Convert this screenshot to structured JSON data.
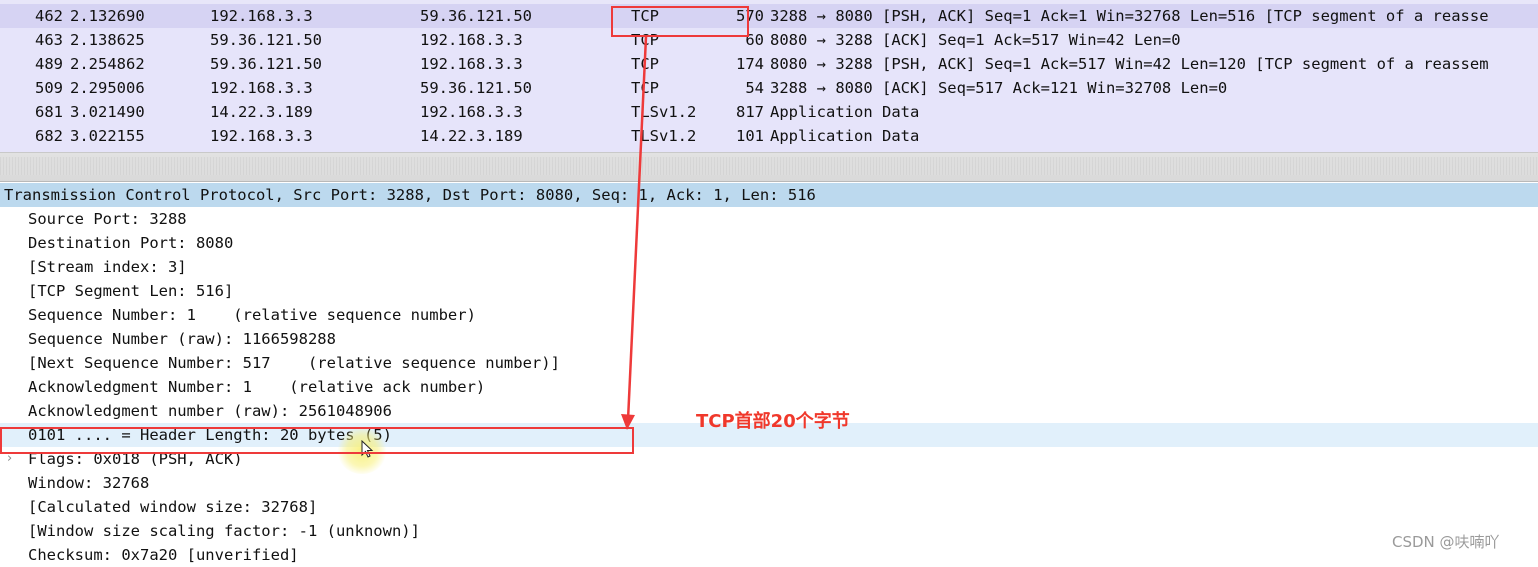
{
  "packet_list": {
    "rows": [
      {
        "no": "462",
        "time": "2.132690",
        "src": "192.168.3.3",
        "dst": "59.36.121.50",
        "proto": "TCP",
        "len": "570",
        "info": "3288 → 8080 [PSH, ACK] Seq=1 Ack=1 Win=32768 Len=516 [TCP segment of a reasse",
        "selected": true
      },
      {
        "no": "463",
        "time": "2.138625",
        "src": "59.36.121.50",
        "dst": "192.168.3.3",
        "proto": "TCP",
        "len": "60",
        "info": "8080 → 3288 [ACK] Seq=1 Ack=517 Win=42 Len=0",
        "selected": false
      },
      {
        "no": "489",
        "time": "2.254862",
        "src": "59.36.121.50",
        "dst": "192.168.3.3",
        "proto": "TCP",
        "len": "174",
        "info": "8080 → 3288 [PSH, ACK] Seq=1 Ack=517 Win=42 Len=120 [TCP segment of a reassem",
        "selected": false
      },
      {
        "no": "509",
        "time": "2.295006",
        "src": "192.168.3.3",
        "dst": "59.36.121.50",
        "proto": "TCP",
        "len": "54",
        "info": "3288 → 8080 [ACK] Seq=517 Ack=121 Win=32708 Len=0",
        "selected": false
      },
      {
        "no": "681",
        "time": "3.021490",
        "src": "14.22.3.189",
        "dst": "192.168.3.3",
        "proto": "TLSv1.2",
        "len": "817",
        "info": "Application Data",
        "selected": false
      },
      {
        "no": "682",
        "time": "3.022155",
        "src": "192.168.3.3",
        "dst": "14.22.3.189",
        "proto": "TLSv1.2",
        "len": "101",
        "info": "Application Data",
        "selected": false
      }
    ]
  },
  "detail": {
    "header": "Transmission Control Protocol, Src Port: 3288, Dst Port: 8080, Seq: 1, Ack: 1, Len: 516",
    "fields": [
      "Source Port: 3288",
      "Destination Port: 8080",
      "[Stream index: 3]",
      "[TCP Segment Len: 516]",
      "Sequence Number: 1    (relative sequence number)",
      "Sequence Number (raw): 1166598288",
      "[Next Sequence Number: 517    (relative sequence number)]",
      "Acknowledgment Number: 1    (relative ack number)",
      "Acknowledgment number (raw): 2561048906",
      "0101 .... = Header Length: 20 bytes (5)",
      "Flags: 0x018 (PSH, ACK)",
      "Window: 32768",
      "[Calculated window size: 32768]",
      "[Window size scaling factor: -1 (unknown)]",
      "Checksum: 0x7a20 [unverified]"
    ],
    "expander_icon": "chevron-right-icon"
  },
  "annotation": {
    "label": "TCP首部20个字节",
    "color": "#ee3a3a"
  },
  "watermark": "CSDN @呋喃吖"
}
